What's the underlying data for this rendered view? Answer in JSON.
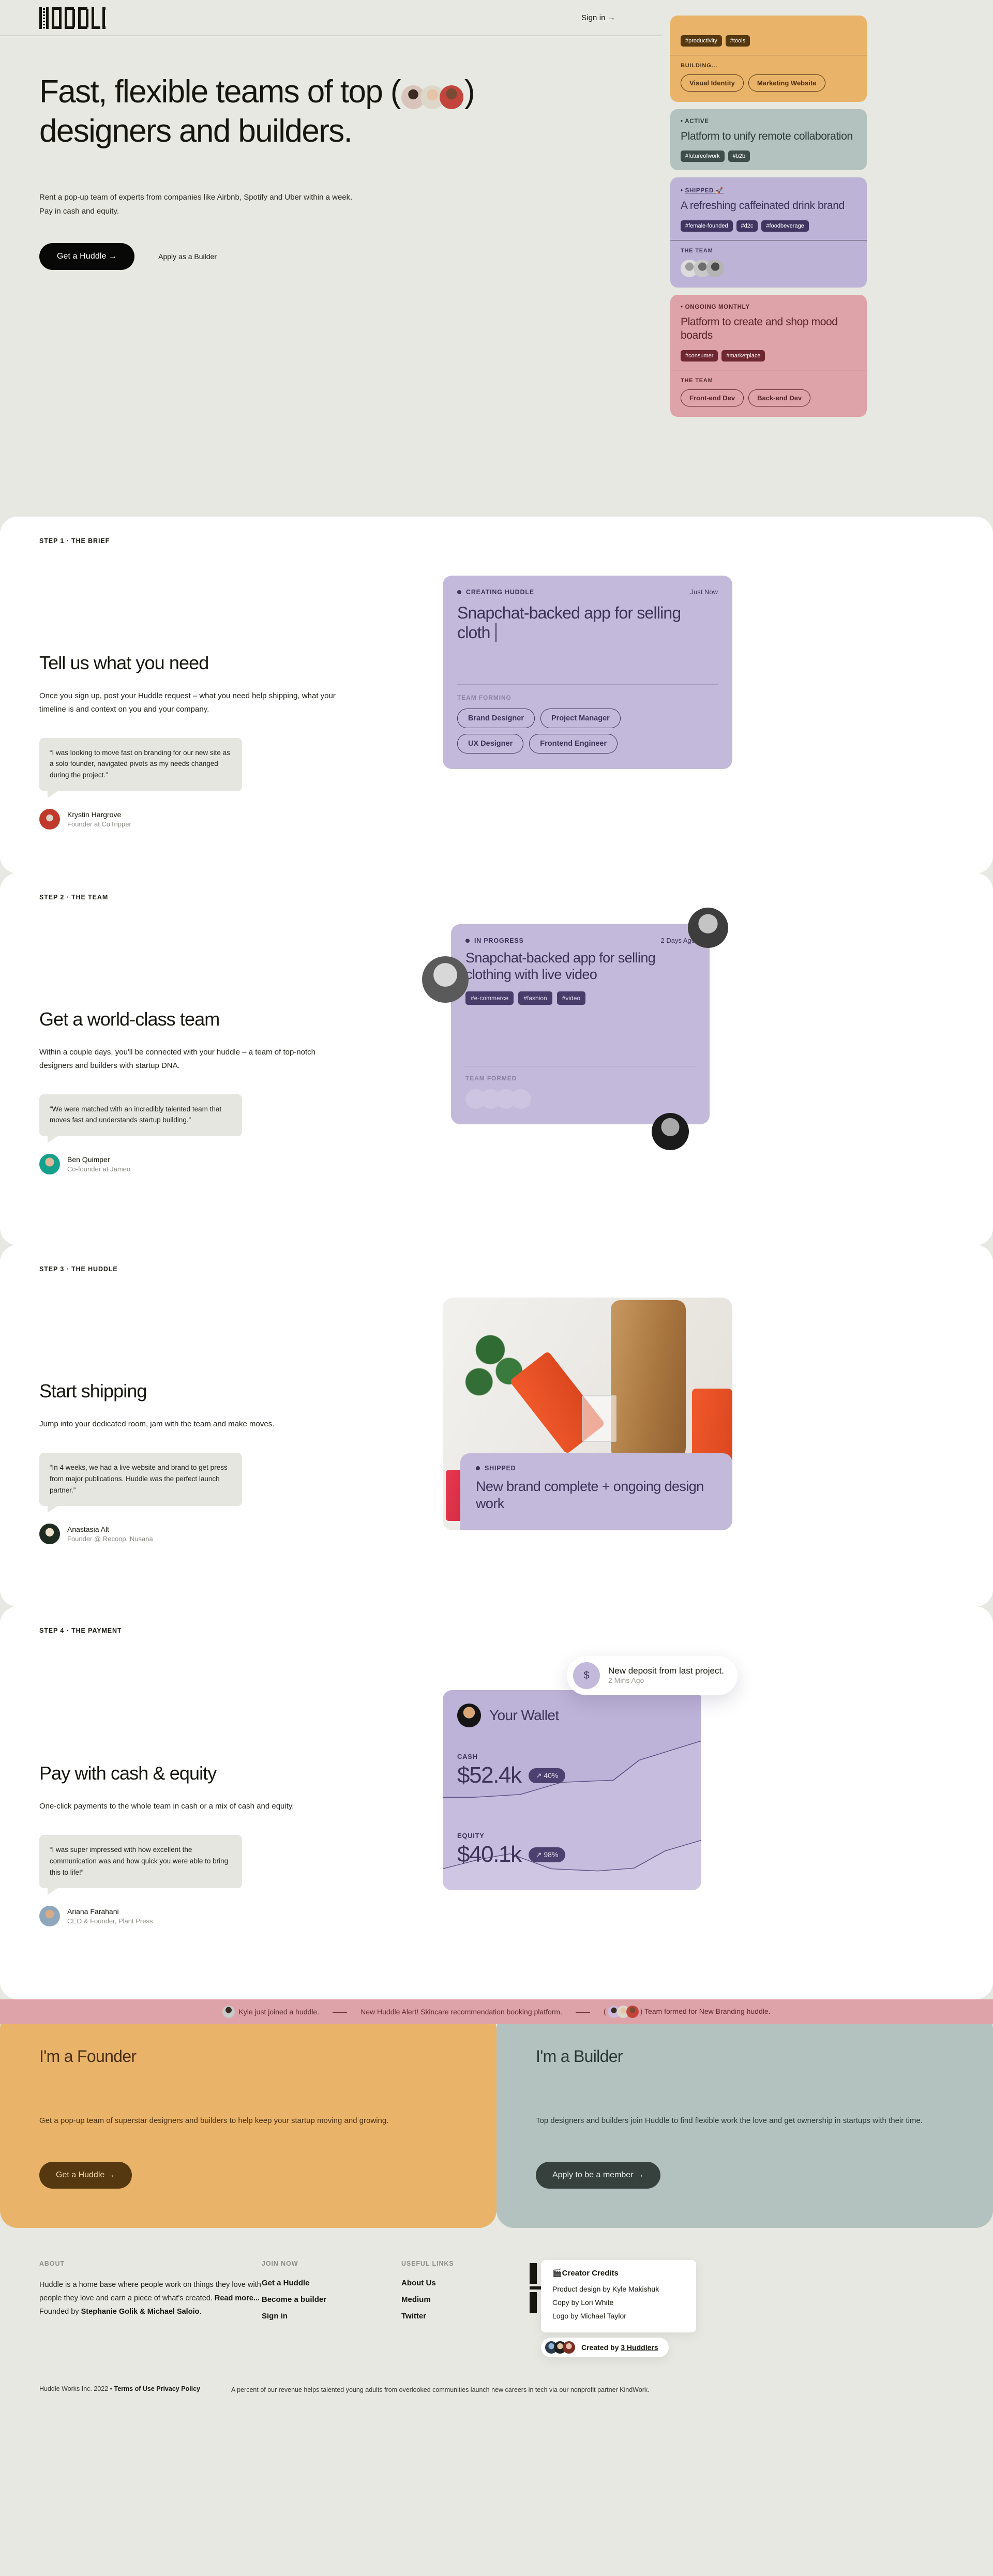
{
  "nav": {
    "logo_text": "HUDDLE",
    "signin": "Sign in →"
  },
  "hero": {
    "title_part1": "Fast, flexible teams of top (",
    "title_part2": ") designers and builders.",
    "subtitle": "Rent a pop-up team of experts from companies like Airbnb, Spotify and Uber within a week. Pay in cash and equity.",
    "primary_cta": "Get a Huddle →",
    "secondary_cta": "Apply as a Builder",
    "cards": [
      {
        "status": "ACTIVE",
        "title": "Platform to unify remote collaboration",
        "tags": [
          "#futureofwork",
          "#b2b"
        ],
        "theme": "c-sage"
      },
      {
        "status": "SHIPPED 🚀",
        "title": "A refreshing caffeinated drink brand",
        "tags": [
          "#female-founded",
          "#d2c",
          "#foodbeverage"
        ],
        "foot_label": "THE TEAM",
        "foot_type": "faces",
        "theme": "c-lilac"
      },
      {
        "status": "ONGOING MONTHLY",
        "title": "Platform to create and shop mood boards",
        "tags": [
          "#consumer",
          "#marketplace"
        ],
        "foot_label": "THE TEAM",
        "foot_type": "pills",
        "pills": [
          "Front-end Dev",
          "Back-end Dev"
        ],
        "theme": "c-rose"
      }
    ],
    "top_card": {
      "tags": [
        "#productivity",
        "#tools"
      ],
      "foot_label": "BUILDING...",
      "pills": [
        "Visual Identity",
        "Marketing Website"
      ],
      "theme": "c-amber"
    }
  },
  "steps": [
    {
      "label": "STEP 1 · THE BRIEF",
      "title": "Tell us what you need",
      "desc": "Once you sign up, post your Huddle request – what you need help shipping, what your timeline is and context on you and your company.",
      "quote": "“I was looking to move fast on branding for our new site as a solo founder, navigated pivots as my needs changed during the project.”",
      "person_name": "Krystin Hargrove",
      "person_role": "Founder at CoTripper",
      "card": {
        "status": "CREATING HUDDLE",
        "time": "Just Now",
        "title": "Snapchat-backed app for selling cloth",
        "foot_label": "TEAM FORMING",
        "roles": [
          "Brand Designer",
          "Project Manager",
          "UX Designer",
          "Frontend Engineer"
        ]
      }
    },
    {
      "label": "STEP 2 · THE TEAM",
      "title": "Get a world-class team",
      "desc": "Within a couple days, you'll be connected with your huddle – a team of top-notch designers and builders with startup DNA.",
      "quote": "“We were matched with an incredibly talented team that moves fast and understands startup building.”",
      "person_name": "Ben Quimper",
      "person_role": "Co-founder at Jameo",
      "card": {
        "status": "IN PROGRESS",
        "time": "2 Days Ago",
        "title": "Snapchat-backed app for selling clothing with live video",
        "tags": [
          "#e-commerce",
          "#fashion",
          "#video"
        ],
        "foot_label": "TEAM FORMED"
      }
    },
    {
      "label": "STEP 3 · THE HUDDLE",
      "title": "Start shipping",
      "desc": "Jump into your dedicated room, jam with the team and make moves.",
      "quote": "“In 4 weeks, we had a live website and brand to get press from major publications. Huddle was the perfect launch partner.”",
      "person_name": "Anastasia Alt",
      "person_role": "Founder @ Recoop, Nusana",
      "card": {
        "status": "SHIPPED",
        "title": "New brand complete + ongoing design work"
      }
    },
    {
      "label": "STEP 4 · THE PAYMENT",
      "title": "Pay with cash & equity",
      "desc": "One-click payments to the whole team in cash or a mix of cash and equity.",
      "quote": "“I was super impressed with how excellent the communication was and how quick you were able to bring this to life!”",
      "person_name": "Ariana Farahani",
      "person_role": "CEO & Founder, Plant Press",
      "wallet": {
        "title": "Your Wallet",
        "cash_label": "CASH",
        "cash_value": "$52.4k",
        "cash_delta": "↗ 40%",
        "equity_label": "EQUITY",
        "equity_value": "$40.1k",
        "equity_delta": "↗ 98%",
        "toast_icon": "$",
        "toast_title": "New deposit from last project.",
        "toast_time": "2 Mins Ago"
      }
    }
  ],
  "ticker": {
    "item1": "Kyle just joined a huddle.",
    "item2": "New Huddle Alert! Skincare recommendation booking platform.",
    "item3": "Team formed for New Branding huddle.",
    "separator": "——"
  },
  "split_cta": [
    {
      "title": "I'm a Founder",
      "desc": "Get a pop-up team of superstar designers and builders to help keep your startup moving and growing.",
      "button": "Get a Huddle →"
    },
    {
      "title": "I'm a Builder",
      "desc": "Top designers and builders join Huddle to find flexible work the love and get ownership in startups with their time.",
      "button": "Apply to be a member →"
    }
  ],
  "footer": {
    "about_head": "ABOUT",
    "about_text_1": "Huddle is a home base where people work on things they love with people they love and earn a piece of what's created.",
    "about_readmore": "Read more...",
    "about_founded_prefix": "Founded by ",
    "about_founders": "Stephanie Golik & Michael Saloio",
    "about_founded_suffix": ".",
    "join_head": "JOIN NOW",
    "join_links": [
      "Get a Huddle",
      "Become a builder",
      "Sign in"
    ],
    "useful_head": "USEFUL LINKS",
    "useful_links": [
      "About Us",
      "Medium",
      "Twitter"
    ],
    "credits_head": "🎬Creator Credits",
    "credits": [
      "Product design by Kyle Makishuk",
      "Copy by Lori White",
      "Logo by Michael Taylor"
    ],
    "created_by_prefix": "Created by ",
    "created_by_link": "3 Huddlers",
    "legal_left": "Huddle Works Inc. 2022 • ",
    "legal_left_link": "Terms of Use Privacy Policy",
    "legal_right": "A percent of our revenue helps talented young adults from overlooked communities launch new careers in tech via our nonprofit partner KindWork."
  },
  "colors": {
    "bg": "#e8e8e2",
    "ink": "#16160f",
    "amber": "#e9b46a",
    "sage": "#b3c2be",
    "lilac": "#bdb3d6",
    "rose": "#dda3a8",
    "purple_card": "#c3b9da",
    "purple_text": "#3d3359"
  }
}
